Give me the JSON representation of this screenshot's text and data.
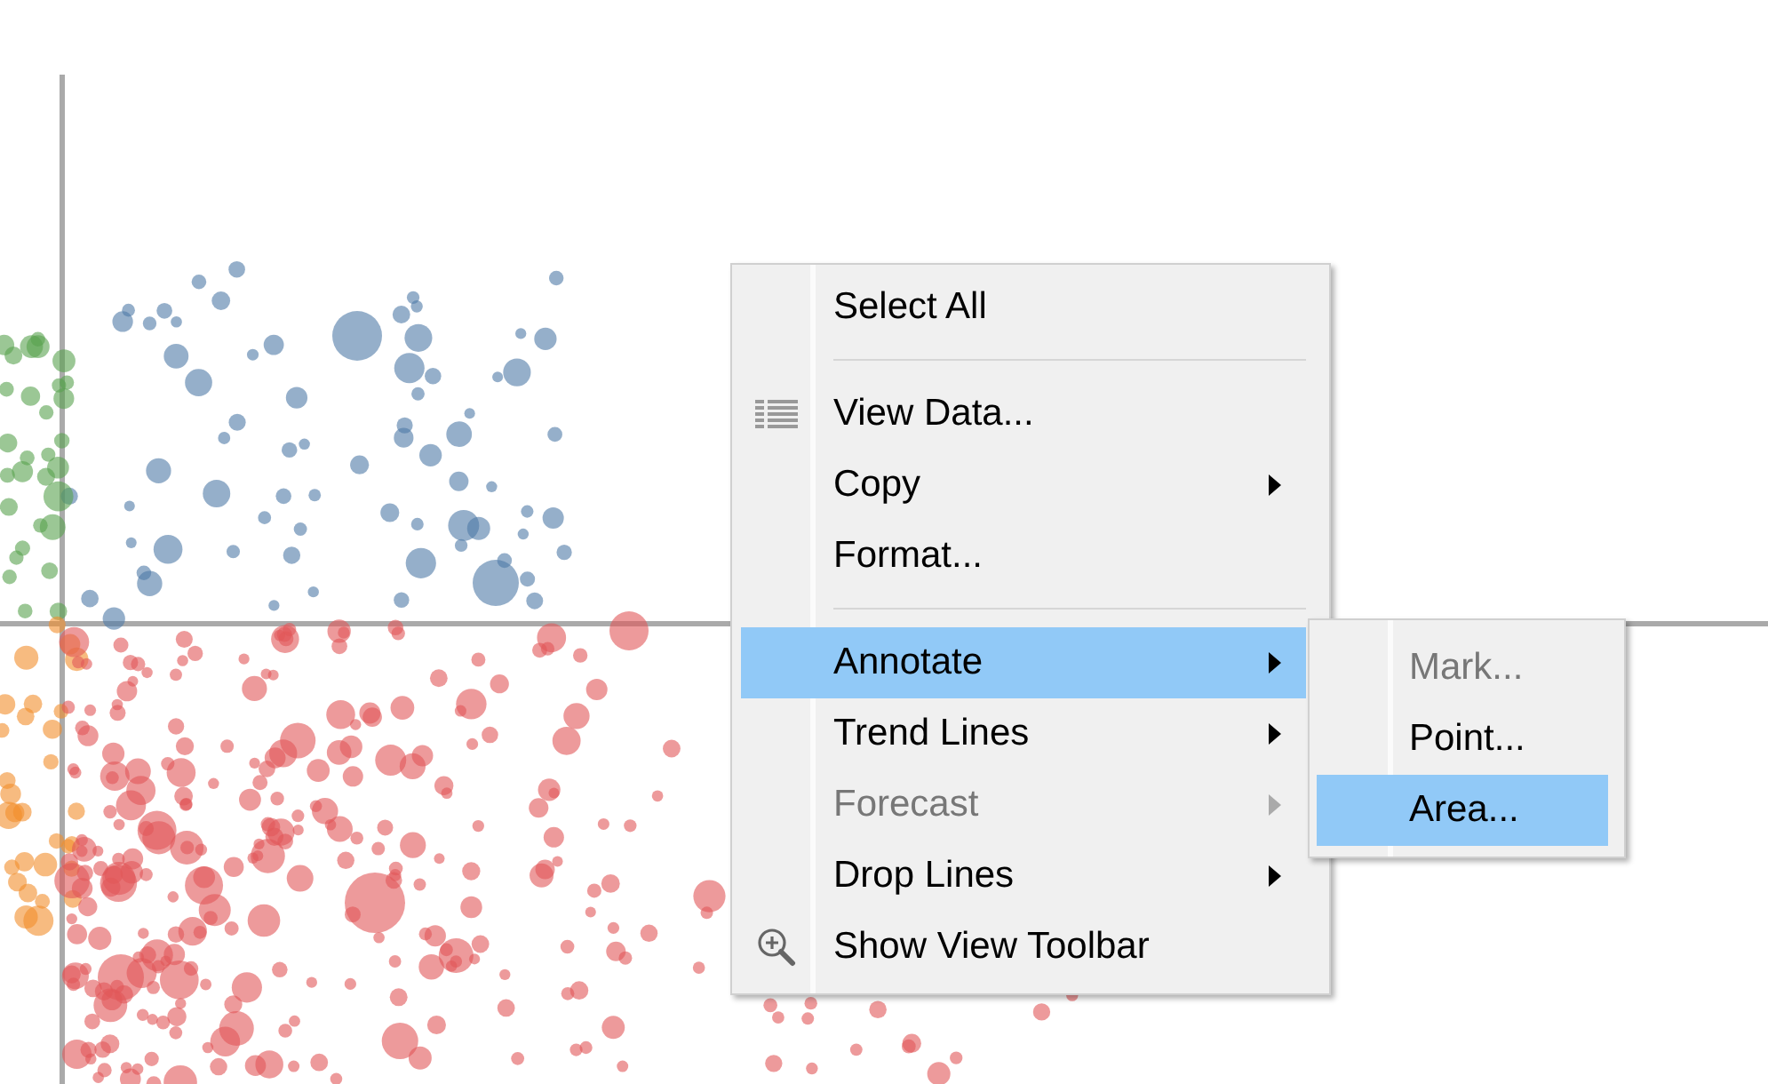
{
  "menu": {
    "items": [
      {
        "kind": "plain",
        "label": "Select All",
        "selected": false,
        "disabled": false,
        "has_submenu": false
      },
      {
        "kind": "separator"
      },
      {
        "kind": "table-icon",
        "label": "View Data...",
        "selected": false,
        "disabled": false,
        "has_submenu": false
      },
      {
        "kind": "plain",
        "label": "Copy",
        "selected": false,
        "disabled": false,
        "has_submenu": true
      },
      {
        "kind": "plain",
        "label": "Format...",
        "selected": false,
        "disabled": false,
        "has_submenu": false
      },
      {
        "kind": "separator"
      },
      {
        "kind": "plain",
        "label": "Annotate",
        "selected": true,
        "disabled": false,
        "has_submenu": true
      },
      {
        "kind": "plain",
        "label": "Trend Lines",
        "selected": false,
        "disabled": false,
        "has_submenu": true
      },
      {
        "kind": "plain",
        "label": "Forecast",
        "selected": false,
        "disabled": true,
        "has_submenu": true
      },
      {
        "kind": "plain",
        "label": "Drop Lines",
        "selected": false,
        "disabled": false,
        "has_submenu": true
      },
      {
        "kind": "zoom-icon",
        "label": "Show View Toolbar",
        "selected": false,
        "disabled": false,
        "has_submenu": false
      }
    ]
  },
  "submenu": {
    "items": [
      {
        "label": "Mark...",
        "selected": false,
        "disabled": true
      },
      {
        "label": "Point...",
        "selected": false,
        "disabled": false
      },
      {
        "label": "Area...",
        "selected": true,
        "disabled": false
      }
    ]
  }
}
